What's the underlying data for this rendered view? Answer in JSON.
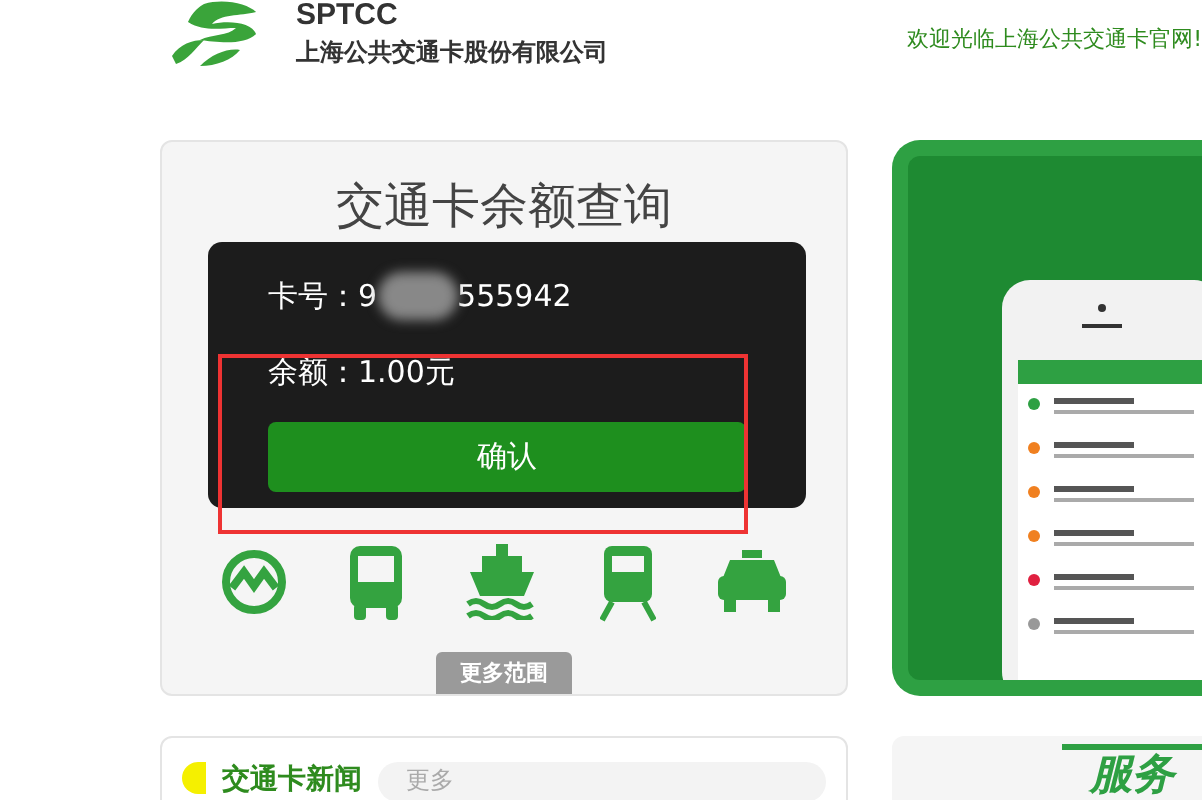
{
  "header": {
    "brand": "SPTCC",
    "company": "上海公共交通卡股份有限公司",
    "welcome": "欢迎光临上海公共交通卡官网!"
  },
  "balance_card": {
    "title": "交通卡余额查询",
    "more_button": "更多范围"
  },
  "dialog": {
    "card_label": "卡号：9",
    "card_tail": "555942",
    "balance": "余额：1.00元",
    "confirm": "确认"
  },
  "news": {
    "title": "交通卡新闻",
    "more": "更多"
  },
  "service": {
    "title": "服务"
  }
}
